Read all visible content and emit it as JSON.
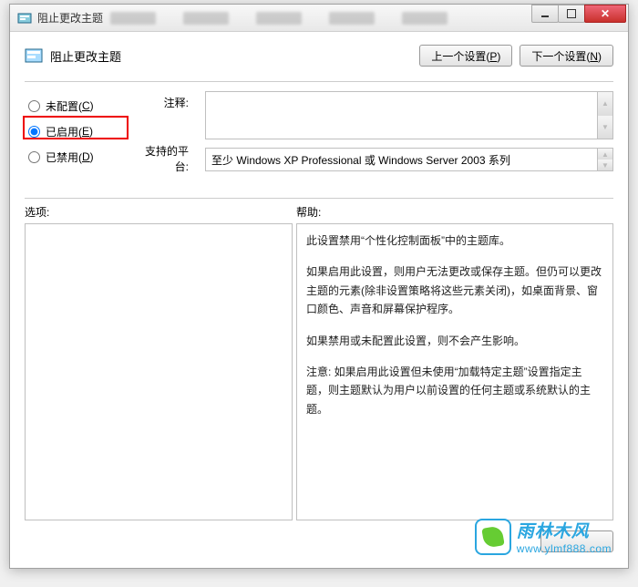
{
  "titlebar": {
    "title": "阻止更改主题"
  },
  "header": {
    "title": "阻止更改主题"
  },
  "nav": {
    "prev": "上一个设置(",
    "prev_key": "P",
    "next": "下一个设置(",
    "next_key": "N",
    "close_paren": ")"
  },
  "radios": {
    "not_configured": "未配置(",
    "nc_key": "C",
    "enabled": "已启用(",
    "en_key": "E",
    "disabled": "已禁用(",
    "dis_key": "D",
    "close_paren": ")"
  },
  "labels": {
    "comment": "注释:",
    "supported": "支持的平台:"
  },
  "supported_text": "至少 Windows XP Professional 或 Windows Server 2003 系列",
  "section": {
    "options": "选项:",
    "help": "帮助:"
  },
  "help": {
    "p1": "此设置禁用“个性化控制面板”中的主题库。",
    "p2": "如果启用此设置，则用户无法更改或保存主题。但仍可以更改主题的元素(除非设置策略将这些元素关闭)，如桌面背景、窗口颜色、声音和屏幕保护程序。",
    "p3": "如果禁用或未配置此设置，则不会产生影响。",
    "p4": "注意: 如果启用此设置但未使用“加载特定主题”设置指定主题，则主题默认为用户以前设置的任何主题或系统默认的主题。"
  },
  "watermark": {
    "cn": "雨林木风",
    "url": "www.ylmf888.com"
  }
}
